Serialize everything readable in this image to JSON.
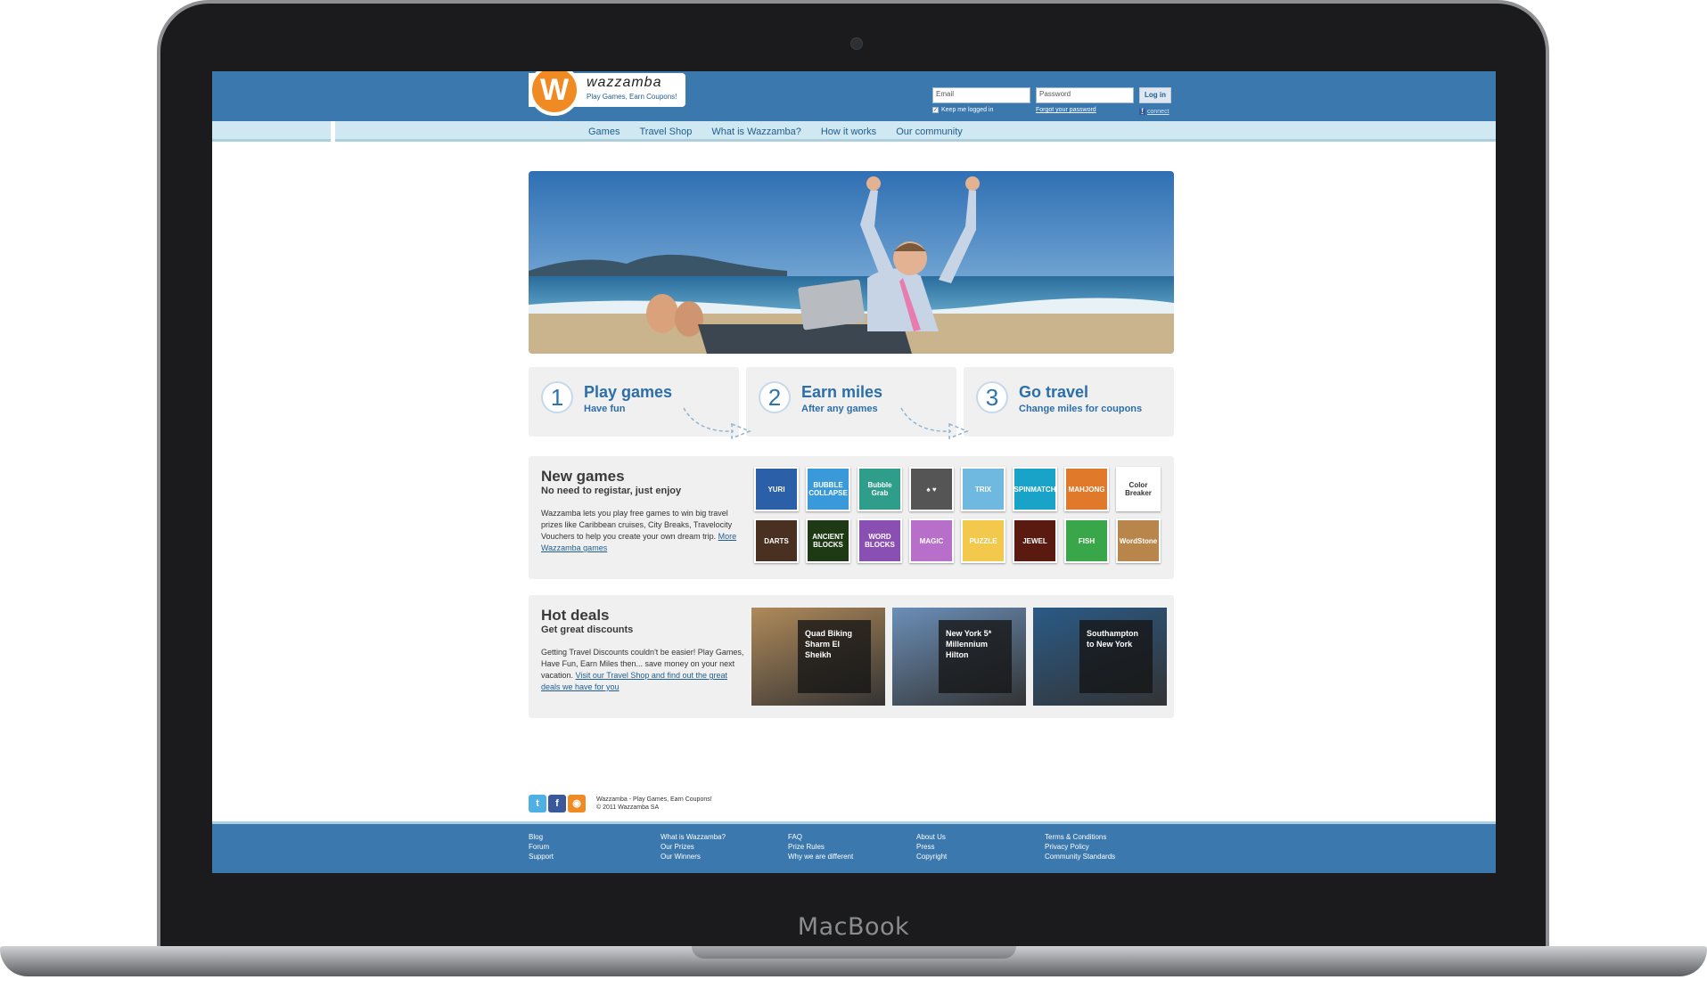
{
  "device": {
    "brand_text": "MacBook"
  },
  "site": {
    "logo_letter": "W",
    "name": "wazzamba",
    "tagline": "Play Games, Earn Coupons!"
  },
  "login": {
    "email_placeholder": "Email",
    "password_placeholder": "Password",
    "button": "Log in",
    "keep_logged": "Keep me logged in",
    "forgot": "Forgot your password",
    "connect": "connect",
    "fb_letter": "f",
    "check_mark": "✓"
  },
  "nav": [
    "Games",
    "Travel Shop",
    "What is Wazzamba?",
    "How it works",
    "Our community"
  ],
  "steps": [
    {
      "num": "1",
      "title": "Play games",
      "sub": "Have fun"
    },
    {
      "num": "2",
      "title": "Earn miles",
      "sub": "After any games"
    },
    {
      "num": "3",
      "title": "Go travel",
      "sub": "Change miles for coupons"
    }
  ],
  "new_games": {
    "title": "New games",
    "subtitle": "No need to registar, just enjoy",
    "text": "Wazzamba lets you play free games to win big travel prizes like Caribbean cruises, City Breaks, Travelocity Vouchers to help you create your own dream trip.",
    "link": "More Wazzamba games",
    "thumbs": [
      {
        "label": "YURI",
        "color": "#2b5fa8"
      },
      {
        "label": "BUBBLE COLLAPSE",
        "color": "#3a9ad9"
      },
      {
        "label": "Bubble Grab",
        "color": "#2e9e8a"
      },
      {
        "label": "♠ ♥",
        "color": "#555555"
      },
      {
        "label": "TRIX",
        "color": "#6fb8e0"
      },
      {
        "label": "SPINMATCH",
        "color": "#1aa3c9"
      },
      {
        "label": "MAHJONG",
        "color": "#e07a2a"
      },
      {
        "label": "Color Breaker",
        "color": "#ffffff"
      },
      {
        "label": "DARTS",
        "color": "#4a3020"
      },
      {
        "label": "ANCIENT BLOCKS",
        "color": "#1e3a14"
      },
      {
        "label": "WORD BLOCKS",
        "color": "#8a4fb3"
      },
      {
        "label": "MAGIC",
        "color": "#b86fc9"
      },
      {
        "label": "PUZZLE",
        "color": "#f2c94c"
      },
      {
        "label": "JEWEL",
        "color": "#5a1a10"
      },
      {
        "label": "FISH",
        "color": "#3aa64a"
      },
      {
        "label": "WordStone",
        "color": "#b8864a"
      }
    ]
  },
  "hot_deals": {
    "title": "Hot deals",
    "subtitle": "Get great discounts",
    "text": "Getting Travel Discounts couldn't be easier! Play Games, Have Fun, Earn Miles then... save money on your next vacation.",
    "link": "Visit our Travel Shop and find out the great deals we have for you",
    "deals": [
      {
        "label": "Quad Biking Sharm El Sheikh",
        "color": "#b08a5a"
      },
      {
        "label": "New York 5* Millennium Hilton",
        "color": "#6b8fb8"
      },
      {
        "label": "Southampton to New York",
        "color": "#2a5a86"
      }
    ]
  },
  "social": {
    "icons": [
      "t",
      "f",
      "◉"
    ],
    "copy_line1": "Wazzamba - Play Games, Earn Coupons!",
    "copy_line2": "© 2011 Wazzamba SA"
  },
  "footer": {
    "columns": [
      [
        "Blog",
        "Forum",
        "Support"
      ],
      [
        "What is Wazzamba?",
        "Our Prizes",
        "Our Winners"
      ],
      [
        "FAQ",
        "Prize Rules",
        "Why we are different"
      ],
      [
        "About Us",
        "Press",
        "Copyright"
      ],
      [
        "Terms & Conditions",
        "Privacy Policy",
        "Community Standards"
      ]
    ]
  },
  "colors": {
    "primary_blue": "#3a78ae",
    "nav_light": "#cfe8f2",
    "logo_orange": "#f08a23",
    "text_blue": "#2c6ea8"
  }
}
